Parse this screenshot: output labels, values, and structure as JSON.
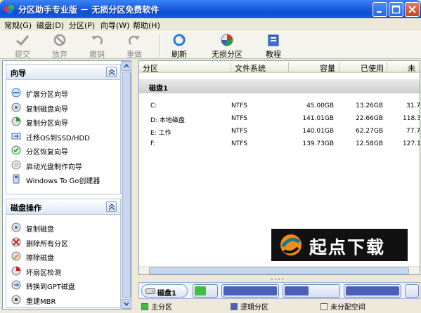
{
  "window": {
    "title": "分区助手专业版 － 无损分区免费软件"
  },
  "menu": [
    "常规(G)",
    "磁盘(D)",
    "分区(P)",
    "向导(W)",
    "帮助(H)"
  ],
  "toolbar": {
    "items": [
      {
        "label": "提交",
        "icon": "commit-icon",
        "enabled": false
      },
      {
        "label": "放弃",
        "icon": "discard-icon",
        "enabled": false
      },
      {
        "label": "撤销",
        "icon": "undo-icon",
        "enabled": false
      },
      {
        "label": "重做",
        "icon": "redo-icon",
        "enabled": false
      },
      {
        "label": "刷新",
        "icon": "refresh-icon",
        "enabled": true
      },
      {
        "label": "无损分区",
        "icon": "partition-icon",
        "enabled": true
      },
      {
        "label": "教程",
        "icon": "tutorial-icon",
        "enabled": true
      }
    ]
  },
  "wizard_panel": {
    "title": "向导",
    "items": [
      "扩展分区向导",
      "复制磁盘向导",
      "复制分区向导",
      "迁移OS到SSD/HDD",
      "分区恢复向导",
      "启动光盘制作向导",
      "Windows To Go创建器"
    ]
  },
  "disk_ops_panel": {
    "title": "磁盘操作",
    "items": [
      "复制磁盘",
      "删除所有分区",
      "擦除磁盘",
      "坏扇区检测",
      "转换到GPT磁盘",
      "重建MBR"
    ]
  },
  "table": {
    "columns": [
      "分区",
      "文件系统",
      "容量",
      "已使用",
      "未"
    ],
    "disk_label": "磁盘1",
    "rows": [
      {
        "partition": "C:",
        "fs": "NTFS",
        "capacity": "45.00GB",
        "used": "13.26GB",
        "free": "31.7"
      },
      {
        "partition": "D: 本地磁盘",
        "fs": "NTFS",
        "capacity": "141.01GB",
        "used": "22.66GB",
        "free": "118.3"
      },
      {
        "partition": "E: 工作",
        "fs": "NTFS",
        "capacity": "140.01GB",
        "used": "62.27GB",
        "free": "77.7"
      },
      {
        "partition": "F:",
        "fs": "NTFS",
        "capacity": "139.73GB",
        "used": "12.58GB",
        "free": "127.1"
      }
    ]
  },
  "watermark": {
    "text": "起点下载"
  },
  "diskmap": {
    "disk_label": "磁盘1"
  },
  "legend": {
    "primary": "主分区",
    "logical": "逻辑分区",
    "unallocated": "未分配空间"
  },
  "colors": {
    "primary": "#3fbf3f",
    "logical": "#4a5fb8",
    "unallocated": "#f5f0dc",
    "titlebar": "#0a4fd2"
  }
}
